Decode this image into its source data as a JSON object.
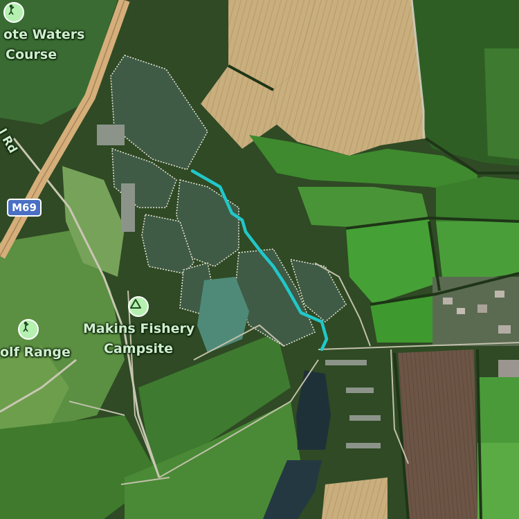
{
  "map": {
    "places": {
      "golf_course": {
        "label_line1": "ote Waters",
        "label_line2": "Course",
        "icon": "golf-icon"
      },
      "golf_range": {
        "label": "olf Range",
        "icon": "golf-icon"
      },
      "campsite": {
        "label_line1": "Makins Fishery",
        "label_line2": "Campsite",
        "icon": "campsite-icon"
      }
    },
    "roads": {
      "motorway_shield": "M69",
      "road_label": "l Rd"
    },
    "route": {
      "color": "#22c7c9"
    },
    "colors": {
      "label_text": "#cfeecf",
      "pin_fill": "#b5f0b0",
      "shield_fill": "#4a6fc4",
      "lake": "#3e5a45",
      "field_wheat": "#c7ad7c",
      "field_green": "#3f8a2f"
    }
  }
}
